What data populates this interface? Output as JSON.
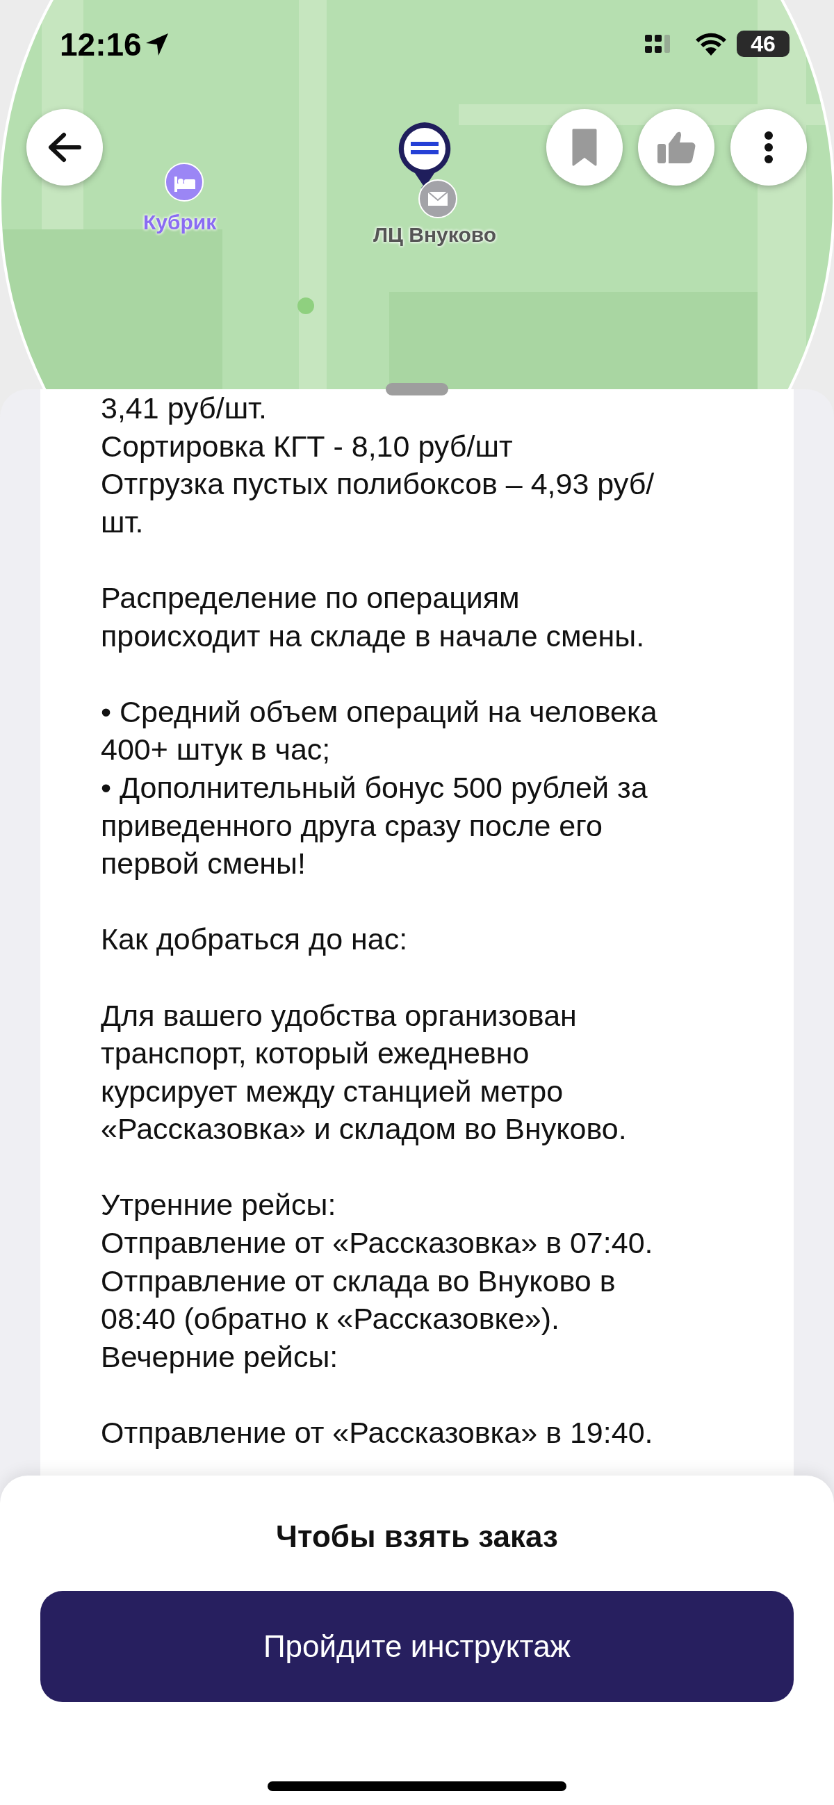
{
  "status_bar": {
    "time": "12:16",
    "battery": "46"
  },
  "map": {
    "pins": [
      {
        "kind": "hotel",
        "label": "Кубрик"
      },
      {
        "kind": "post",
        "label": "ЛЦ Внуково"
      }
    ]
  },
  "description": {
    "paragraphs": [
      [
        "3,41 руб/шт.",
        "Сортировка КГТ - 8,10 руб/шт",
        "Отгрузка пустых полибоксов – 4,93 руб/",
        "шт."
      ],
      [
        "Распределение по операциям",
        "происходит на складе в начале смены."
      ],
      [
        "• Средний объем операций на человека",
        "400+ штук в час;",
        "• Дополнительный бонус 500 рублей за",
        "приведенного друга сразу после его",
        "первой смены!"
      ],
      [
        "Как добраться до нас:"
      ],
      [
        "Для вашего удобства организован",
        "транспорт, который ежедневно",
        "курсирует между станцией метро",
        "«Рассказовка» и складом во Внуково."
      ],
      [
        "Утренние рейсы:",
        "Отправление от «Рассказовка» в 07:40.",
        "Отправление от склада во Внуково в",
        "08:40 (обратно к «Рассказовке»).",
        "Вечерние рейсы:"
      ],
      [
        "Отправление от «Рассказовка» в 19:40."
      ]
    ]
  },
  "action_panel": {
    "title": "Чтобы взять заказ",
    "button": "Пройдите инструктаж"
  }
}
